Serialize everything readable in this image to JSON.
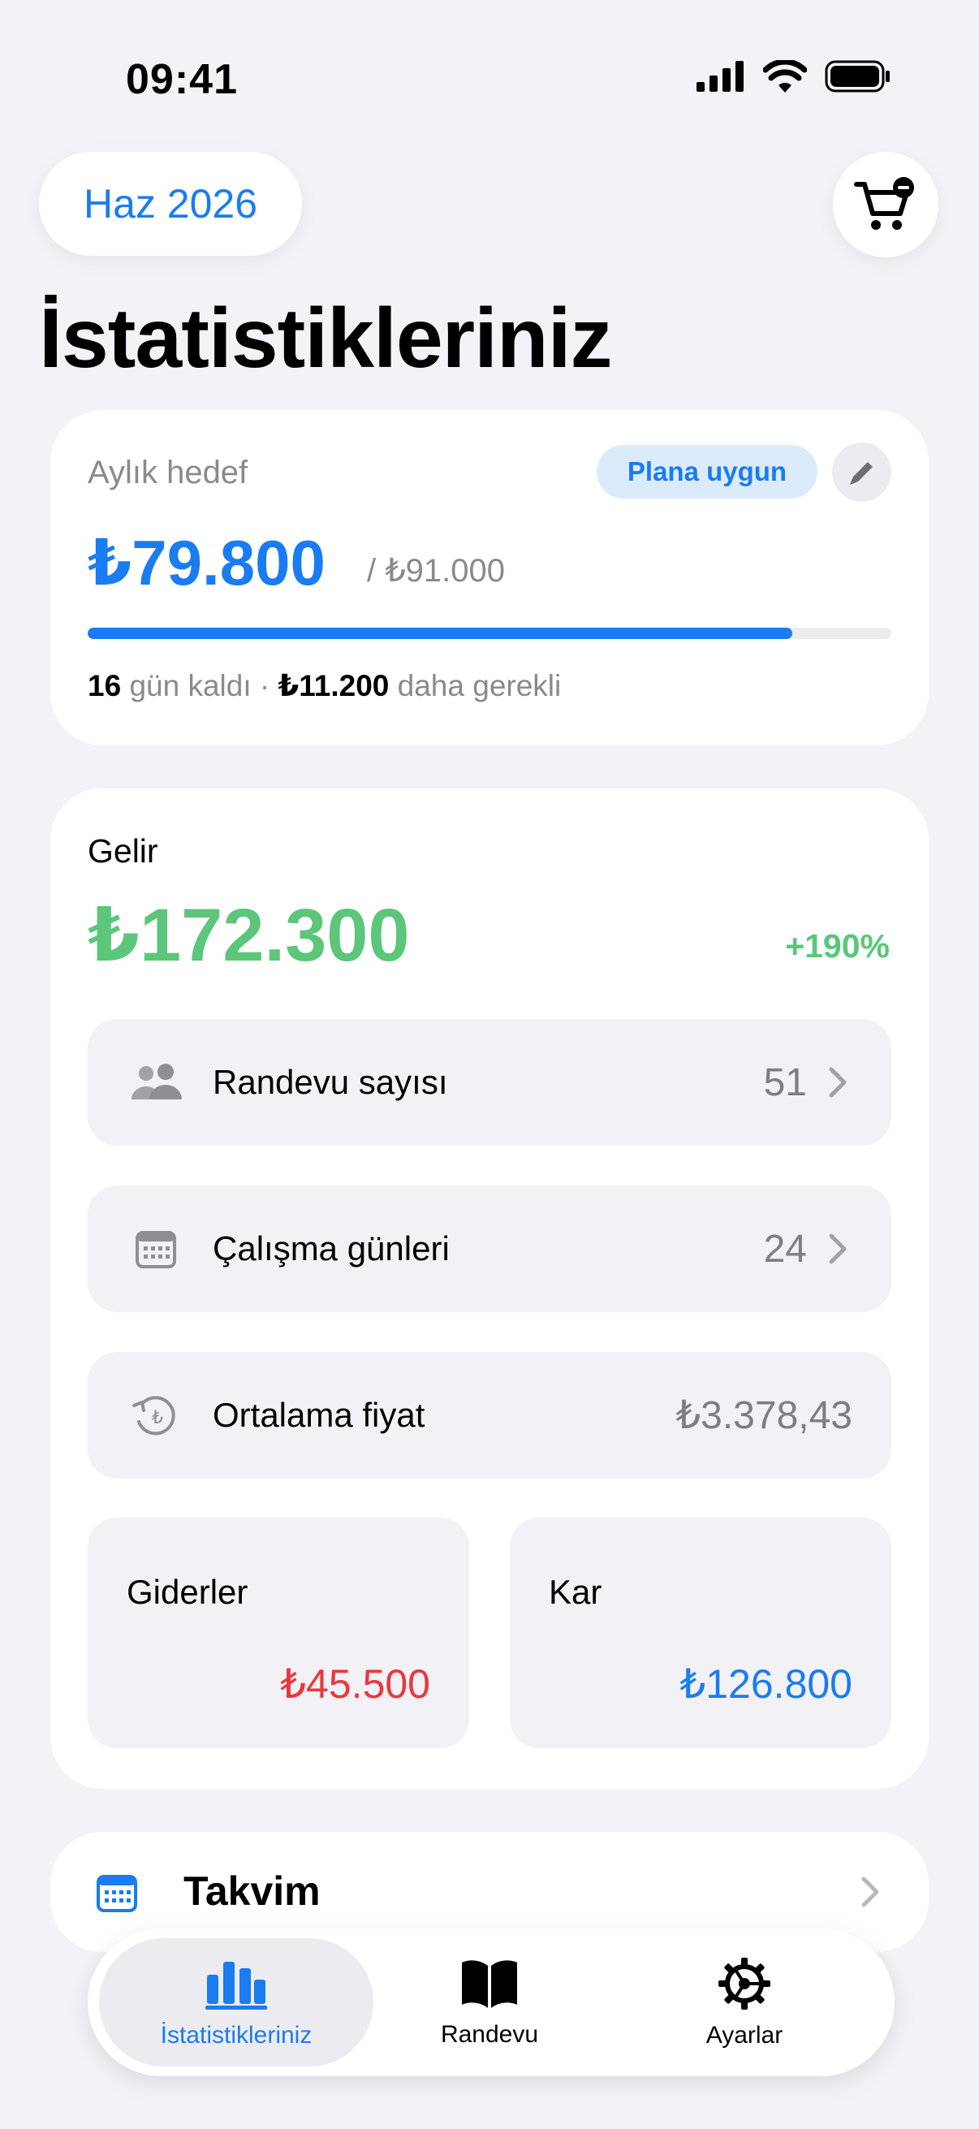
{
  "status_bar": {
    "time": "09:41"
  },
  "header": {
    "month": "Haz 2026",
    "title": "İstatistikleriniz",
    "cart_icon": "cart-minus-icon"
  },
  "goal": {
    "label": "Aylık hedef",
    "badge": "Plana uygun",
    "amount": "₺79.800",
    "target": "/ ₺91.000",
    "progress": 0.877,
    "days_left": "16",
    "days_text": "gün kaldı ·",
    "needed": "₺11.200",
    "needed_text": "daha gerekli"
  },
  "income": {
    "label": "Gelir",
    "amount": "₺172.300",
    "change": "+190%",
    "rows": [
      {
        "icon": "people-icon",
        "label": "Randevu sayısı",
        "value": "51"
      },
      {
        "icon": "calendar-icon",
        "label": "Çalışma günleri",
        "value": "24"
      },
      {
        "icon": "lira-refresh-icon",
        "label": "Ortalama fiyat",
        "value": "₺3.378,43"
      }
    ],
    "expenses": {
      "label": "Giderler",
      "value": "₺45.500"
    },
    "profit": {
      "label": "Kar",
      "value": "₺126.800"
    }
  },
  "calendar": {
    "label": "Takvim"
  },
  "tabs": [
    {
      "label": "İstatistikleriniz",
      "icon": "chart-bar-icon",
      "active": true
    },
    {
      "label": "Randevu",
      "icon": "book-icon",
      "active": false
    },
    {
      "label": "Ayarlar",
      "icon": "gear-icon",
      "active": false
    }
  ],
  "colors": {
    "accent": "#1a7cf0",
    "positive": "#5cc67a",
    "negative": "#e8383d",
    "background": "#f2f2f7"
  }
}
